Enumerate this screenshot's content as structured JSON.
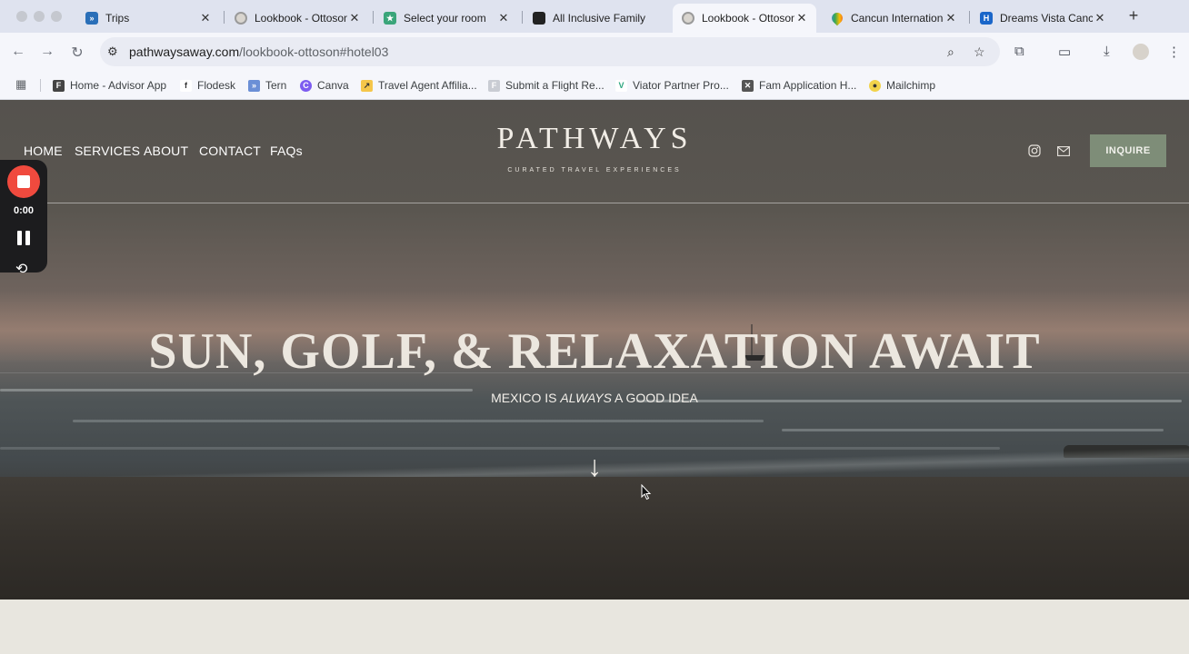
{
  "browser": {
    "tabs": [
      {
        "title": "Trips",
        "favicon": "sail-logo-icon",
        "color": "#2a6fb8",
        "glyph": "»",
        "active": false
      },
      {
        "title": "Lookbook - Ottoson",
        "favicon": "globe-icon",
        "color": "#8a8a8a",
        "glyph": "",
        "active": false
      },
      {
        "title": "Select your room",
        "favicon": "star-icon",
        "color": "#3aa57a",
        "glyph": "★",
        "active": false
      },
      {
        "title": "All Inclusive Family",
        "favicon": "photo-icon",
        "color": "#222222",
        "glyph": "",
        "active": false
      },
      {
        "title": "Lookbook - Ottoson",
        "favicon": "globe-icon",
        "color": "#8a8a8a",
        "glyph": "",
        "active": true
      },
      {
        "title": "Cancun International",
        "favicon": "maps-pin-icon",
        "color": "#e94235",
        "glyph": "",
        "active": false
      },
      {
        "title": "Dreams Vista Cancun",
        "favicon": "hotels-icon",
        "color": "#1a66c9",
        "glyph": "H",
        "active": false
      }
    ],
    "url_domain": "pathwaysaway.com",
    "url_path": "/lookbook-ottoson#hotel03",
    "bookmarks": [
      {
        "label": "Home - Advisor App",
        "color": "#444444",
        "glyph": "F"
      },
      {
        "label": "Flodesk",
        "color": "#ffffff",
        "glyph": "f"
      },
      {
        "label": "Tern",
        "color": "#6b8fd6",
        "glyph": "»"
      },
      {
        "label": "Canva",
        "color": "#7d5cf0",
        "glyph": "C"
      },
      {
        "label": "Travel Agent Affilia...",
        "color": "#f5c64a",
        "glyph": "↗"
      },
      {
        "label": "Submit a Flight Re...",
        "color": "#c9ccd3",
        "glyph": "F"
      },
      {
        "label": "Viator Partner Pro...",
        "color": "#ffffff",
        "glyph": "V"
      },
      {
        "label": "Fam Application H...",
        "color": "#555555",
        "glyph": "✕"
      },
      {
        "label": "Mailchimp",
        "color": "#f2d34a",
        "glyph": "●"
      }
    ]
  },
  "site": {
    "nav": [
      "HOME",
      "SERVICES",
      "ABOUT",
      "CONTACT",
      "FAQs"
    ],
    "logo": "PATHWAYS",
    "tagline": "CURATED TRAVEL EXPERIENCES",
    "inquire_label": "INQUIRE",
    "headline": "SUN, GOLF, & RELAXATION AWAIT",
    "subhead_before": "MEXICO IS ",
    "subhead_em": "ALWAYS",
    "subhead_after": " A GOOD IDEA",
    "scroll_arrow": "↓"
  },
  "recorder": {
    "time": "0:00"
  },
  "colors": {
    "inquire_bg": "#7e8d78",
    "record_red": "#f04a3e",
    "page_bg": "#e8e6df"
  }
}
